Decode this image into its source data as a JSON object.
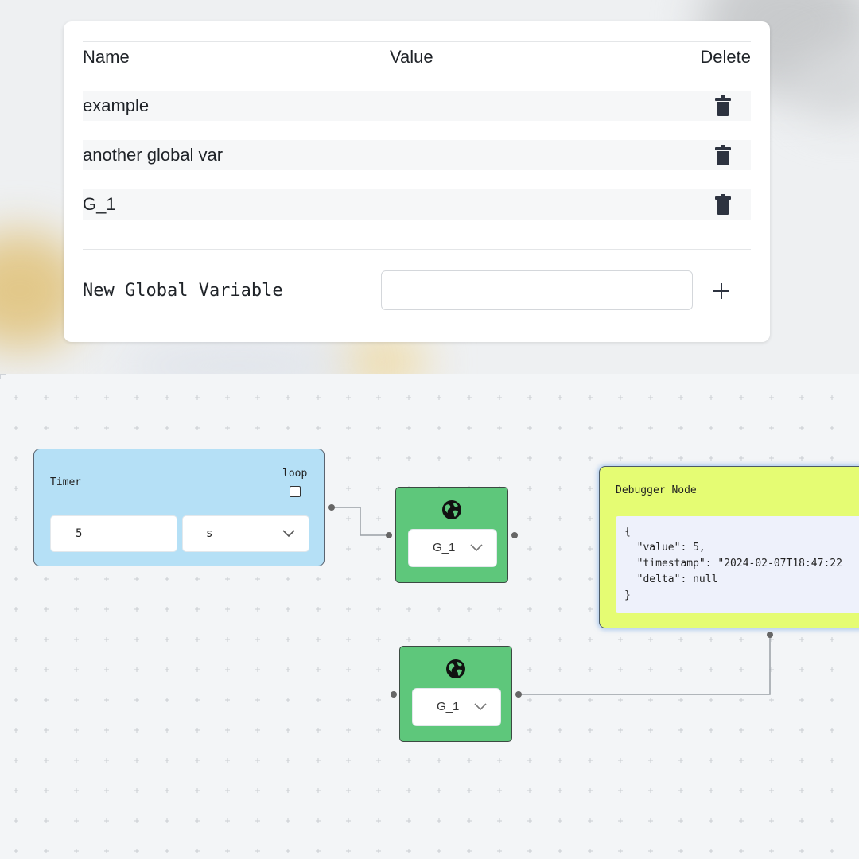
{
  "globals_panel": {
    "columns": {
      "name": "Name",
      "value": "Value",
      "delete": "Delete"
    },
    "rows": [
      {
        "name": "example"
      },
      {
        "name": "another global var"
      },
      {
        "name": "G_1"
      }
    ],
    "new_variable_label": "New Global Variable",
    "new_variable_value": "",
    "add_icon": "plus-icon",
    "delete_icon": "trash-icon"
  },
  "canvas": {
    "timer_node": {
      "title": "Timer",
      "loop_label": "loop",
      "loop_checked": false,
      "interval_value": "5",
      "unit_value": "s"
    },
    "global_node_1": {
      "icon": "globe-icon",
      "selected": "G_1"
    },
    "global_node_2": {
      "icon": "globe-icon",
      "selected": "G_1"
    },
    "debugger_node": {
      "title": "Debugger Node",
      "output": "{\n  \"value\": 5,\n  \"timestamp\": \"2024-02-07T18:47:22\n  \"delta\": null\n}"
    }
  },
  "colors": {
    "timer_node": "#b5e0f6",
    "global_node": "#5ec77b",
    "debugger_node": "#e5fc73",
    "icon_dark": "#2d3340"
  }
}
